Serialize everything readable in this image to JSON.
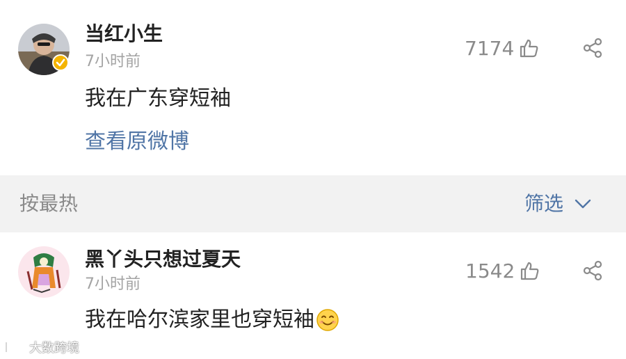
{
  "post": {
    "username": "当红小生",
    "time": "7小时前",
    "like_count": "7174",
    "text": "我在广东穿短袖",
    "view_original_link": "查看原微博"
  },
  "sort_bar": {
    "sort_label": "按最热",
    "filter_label": "筛选"
  },
  "comments": [
    {
      "username": "黑丫头只想过夏天",
      "time": "7小时前",
      "like_count": "1542",
      "text": "我在哈尔滨家里也穿短袖",
      "emoji": "smile-emoji"
    }
  ],
  "watermark": {
    "text": "大数跨境"
  },
  "colors": {
    "link_blue": "#5075a6",
    "muted_gray": "#8a8a8a",
    "timestamp_gray": "#a3a3a3",
    "section_bg": "#f2f2f2",
    "verified_gold": "#f4b400"
  }
}
